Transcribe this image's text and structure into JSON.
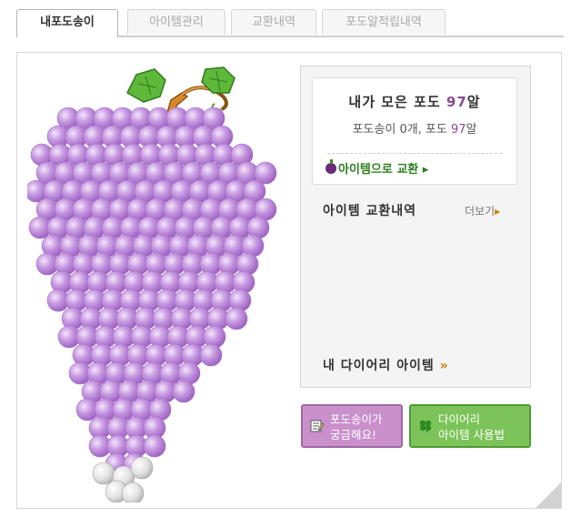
{
  "tabs": [
    {
      "label": "내포도송이",
      "active": true
    },
    {
      "label": "아이템관리",
      "active": false
    },
    {
      "label": "교환내역",
      "active": false
    },
    {
      "label": "포도알적립내역",
      "active": false
    }
  ],
  "summary": {
    "collected_prefix": "내가 모은 포도 ",
    "collected_count": "97",
    "collected_suffix": "알",
    "counts_prefix": "포도송이 0개, 포도 ",
    "counts_grapes": "97",
    "counts_suffix": "알",
    "exchange_label": "아이템으로 교환",
    "exchange_arrow": "▸"
  },
  "history": {
    "title": "아이템 교환내역",
    "more_label": "더보기",
    "more_arrow": "▸"
  },
  "diary": {
    "label": "내 다이어리 아이템",
    "arrow": "»"
  },
  "buttons": {
    "curious_line1": "포도송이가",
    "curious_line2": "궁금해요!",
    "usage_line1": "다이어리",
    "usage_line2": "아이템 사용법"
  },
  "grape": {
    "filled_color": "#c59ae0",
    "empty_color": "#dcdcdc"
  }
}
